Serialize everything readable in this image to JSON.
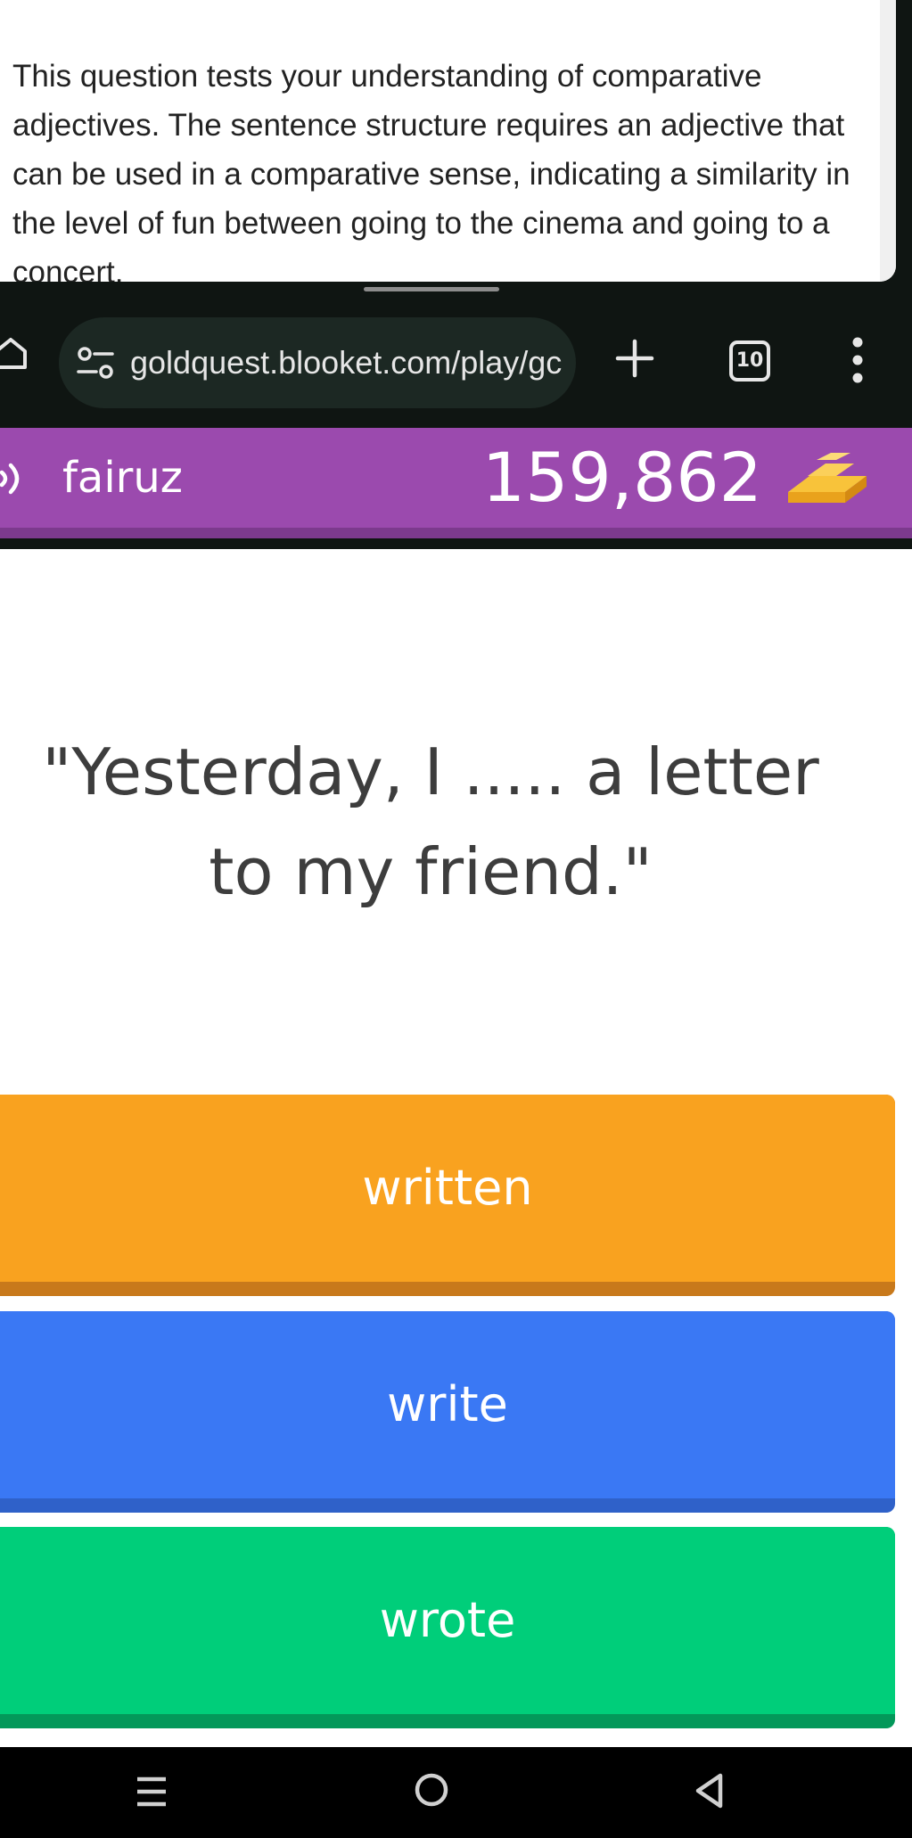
{
  "explanation": {
    "text": "This question tests your understanding of comparative adjectives. The sentence structure requires an adjective that can be used in a comparative sense, indicating a similarity in the level of fun between going to the cinema and going to a concert."
  },
  "browser": {
    "url": "goldquest.blooket.com/play/gc",
    "tab_count": "10",
    "icons": {
      "home": "home-icon",
      "site_settings": "tune-icon",
      "new_tab": "plus-icon",
      "tabs": "tab-switcher-icon",
      "menu": "more-vert-icon"
    }
  },
  "game_bar": {
    "player_name": "fairuz",
    "gold": "159,862",
    "colors": {
      "bar": "#9b4aae",
      "bar_shadow": "#7c3a8d"
    }
  },
  "question": {
    "text": "\"Yesterday, I ..... a letter to my friend.\""
  },
  "answers": [
    {
      "label": "written",
      "color": "#f9a21f"
    },
    {
      "label": "write",
      "color": "#3a78f4"
    },
    {
      "label": "wrote",
      "color": "#00ce7a"
    }
  ],
  "system_nav": {
    "icons": [
      "recents-icon",
      "home-circle-icon",
      "back-icon"
    ]
  }
}
